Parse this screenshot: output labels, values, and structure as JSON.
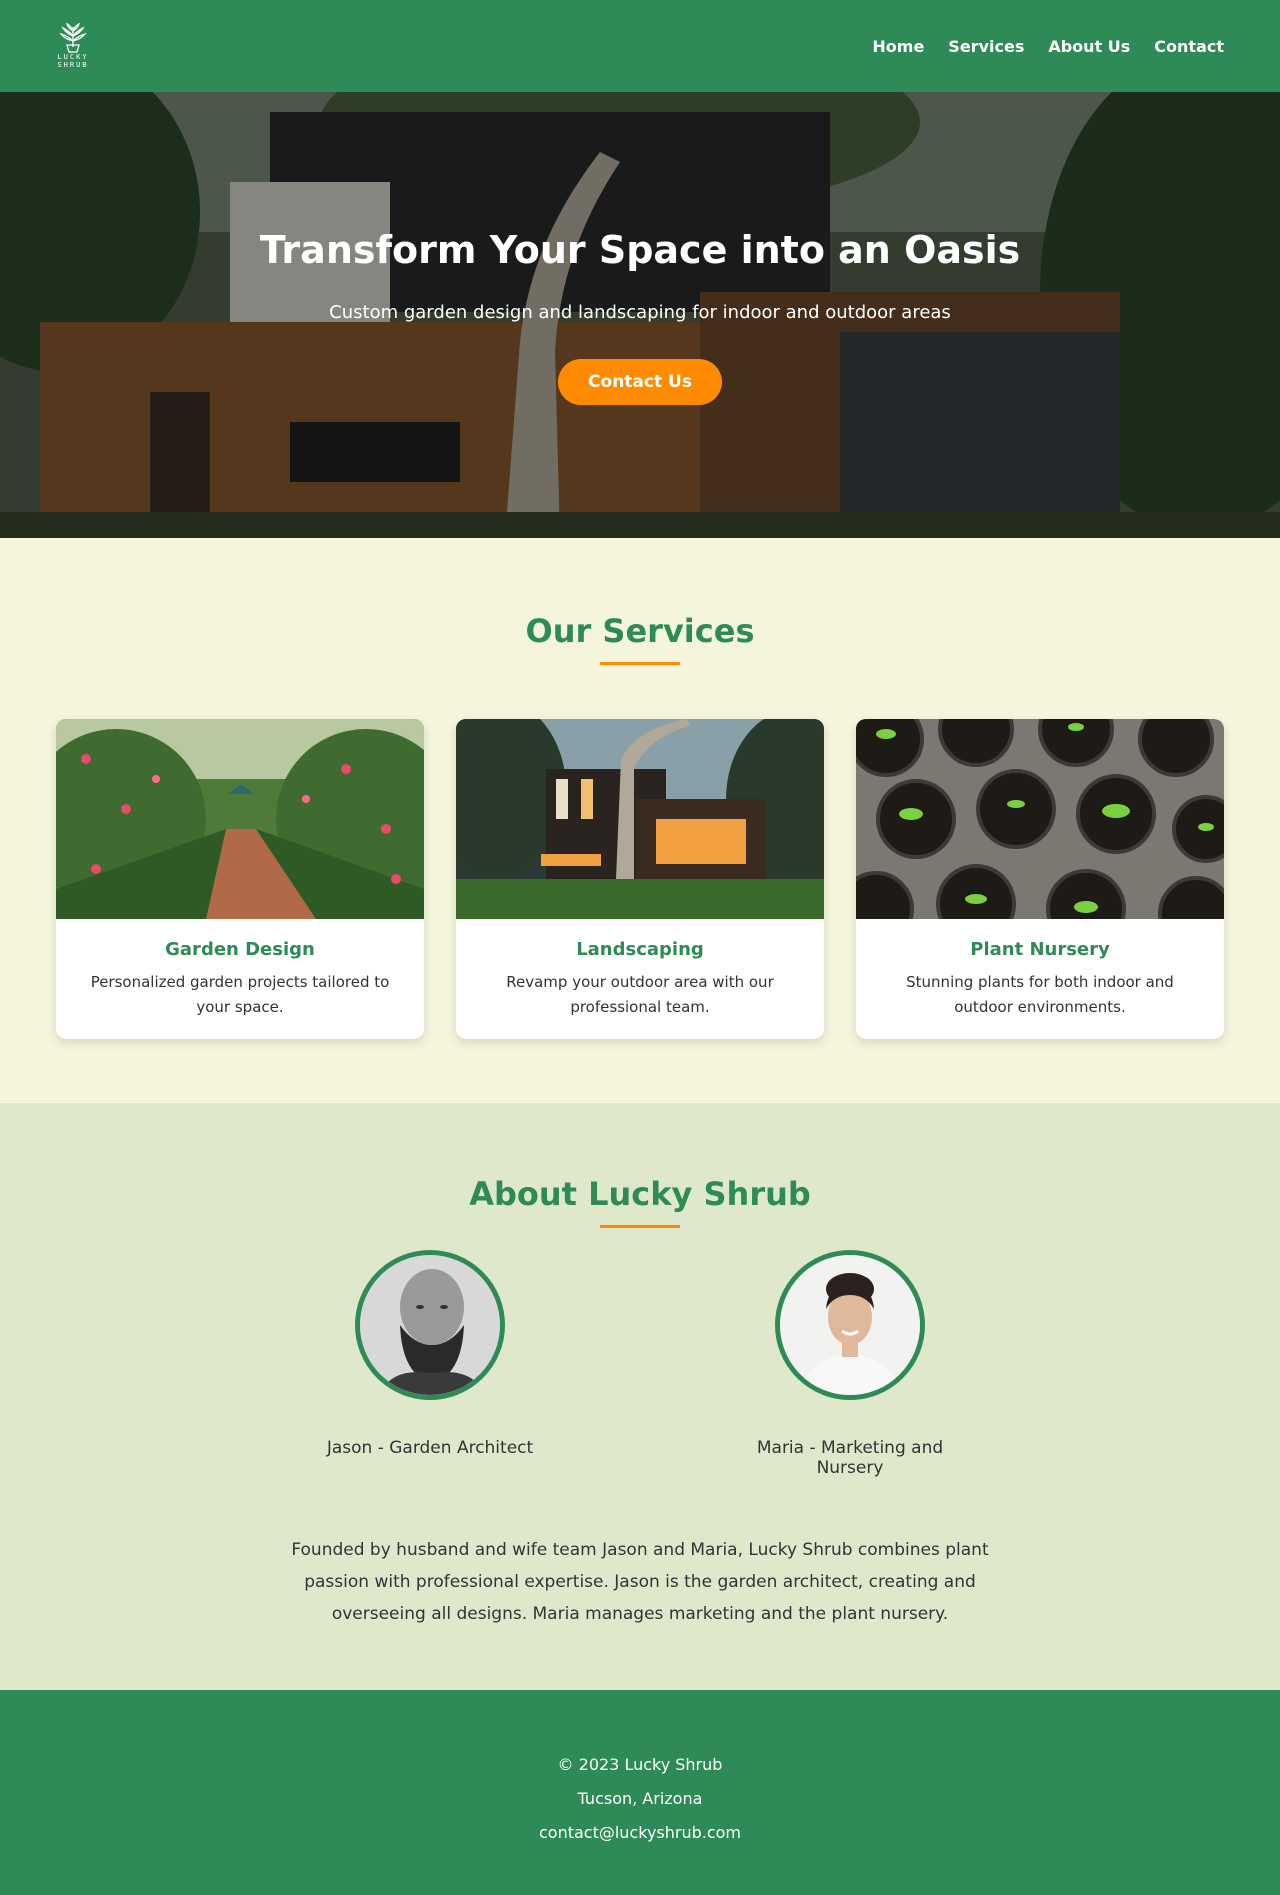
{
  "header": {
    "logo_text_line1": "LUCKY",
    "logo_text_line2": "SHRUB",
    "nav": [
      "Home",
      "Services",
      "About Us",
      "Contact"
    ]
  },
  "hero": {
    "title": "Transform Your Space into an Oasis",
    "subtitle": "Custom garden design and landscaping for indoor and outdoor areas",
    "cta_label": "Contact Us"
  },
  "services": {
    "title": "Our Services",
    "cards": [
      {
        "title": "Garden Design",
        "text": "Personalized garden projects tailored to your space.",
        "image": "garden-path-photo"
      },
      {
        "title": "Landscaping",
        "text": "Revamp your outdoor area with our professional team.",
        "image": "modern-house-photo"
      },
      {
        "title": "Plant Nursery",
        "text": "Stunning plants for both indoor and outdoor environments.",
        "image": "seedling-pots-photo"
      }
    ]
  },
  "about": {
    "title": "About Lucky Shrub",
    "team": [
      {
        "name": "Jason - Garden Architect",
        "photo": "jason-portrait"
      },
      {
        "name": "Maria - Marketing and Nursery",
        "photo": "maria-portrait"
      }
    ],
    "text": "Founded by husband and wife team Jason and Maria, Lucky Shrub combines plant passion with professional expertise. Jason is the garden architect, creating and overseeing all designs. Maria manages marketing and the plant nursery."
  },
  "footer": {
    "copyright": "© 2023 Lucky Shrub",
    "location": "Tucson, Arizona",
    "email": "contact@luckyshrub.com"
  },
  "colors": {
    "primary": "#2e8b57",
    "accent": "#ff8c00",
    "services_bg": "#f5f5dc",
    "about_bg": "#e0e8cc"
  }
}
